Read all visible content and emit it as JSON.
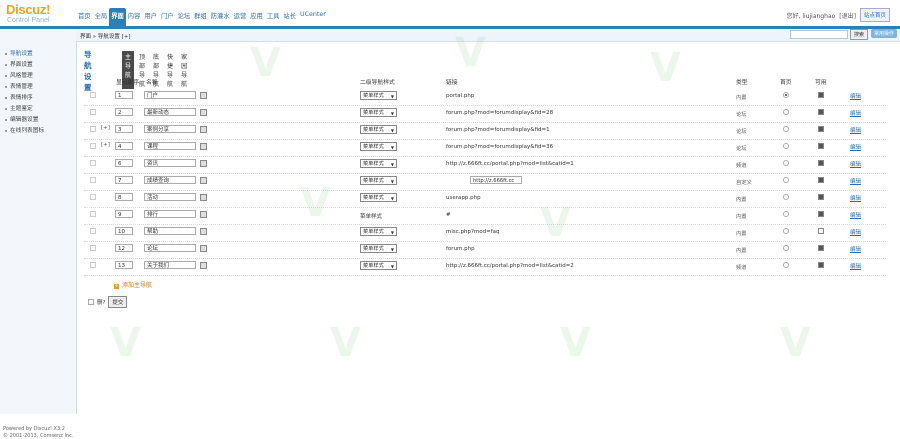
{
  "logo": {
    "name": "Discuz!",
    "sub": "Control Panel"
  },
  "nav": [
    "首页",
    "全局",
    "界面",
    "内容",
    "用户",
    "门户",
    "论坛",
    "群组",
    "防灌水",
    "运营",
    "应用",
    "工具",
    "站长",
    "UCenter"
  ],
  "nav_active_index": 2,
  "user": {
    "greeting": "您好, liujianghao",
    "logout": "[退出]",
    "site_home": "站点首页"
  },
  "breadcrumb": "界面 » 导航设置 [+]",
  "search": {
    "button": "搜索",
    "button2": "常用操作"
  },
  "sidebar": [
    "导航设置",
    "界面设置",
    "风格管理",
    "表情管理",
    "表情排序",
    "主题鉴定",
    "编辑器设置",
    "在线列表图标"
  ],
  "sidebar_active_index": 0,
  "powered": [
    "Powered by Discuz! X3.2",
    "© 2001-2013, Comsenz Inc."
  ],
  "page_title": "导航设置",
  "tabs": [
    "主导航",
    "顶部导航",
    "底部导航",
    "快捷导航",
    "家园导航"
  ],
  "tabs_active_index": 0,
  "headers": {
    "order": "显示顺序",
    "name": "名称",
    "submenu": "二级导航样式",
    "url": "链接",
    "type": "类型",
    "home": "首页",
    "enable": "可用"
  },
  "rows": [
    {
      "expand": "",
      "order": "1",
      "name": "门户",
      "submenu": "菜单样式",
      "url": "portal.php",
      "type": "内置",
      "home": true,
      "enabled": true,
      "edit": "编辑"
    },
    {
      "expand": "",
      "order": "2",
      "name": "最新动态",
      "submenu": "菜单样式",
      "url": "forum.php?mod=forumdisplay&fid=28",
      "type": "论坛",
      "home": false,
      "enabled": true,
      "edit": "编辑"
    },
    {
      "expand": "[+]",
      "order": "3",
      "name": "案例分享",
      "submenu": "菜单样式",
      "url": "forum.php?mod=forumdisplay&fid=1",
      "type": "论坛",
      "home": false,
      "enabled": true,
      "edit": "编辑"
    },
    {
      "expand": "[+]",
      "order": "4",
      "name": "课程",
      "submenu": "菜单样式",
      "url": "forum.php?mod=forumdisplay&fid=36",
      "type": "论坛",
      "home": false,
      "enabled": true,
      "edit": "编辑"
    },
    {
      "expand": "",
      "order": "6",
      "name": "资讯",
      "submenu": "菜单样式",
      "url": "http://z.666ft.cc/portal.php?mod=list&catid=1",
      "type": "频道",
      "home": false,
      "enabled": true,
      "edit": "编辑"
    },
    {
      "expand": "",
      "order": "7",
      "name": "成绩查询",
      "submenu": "菜单样式",
      "urlbox": "http://z.666ft.cc",
      "type": "自定义",
      "home": false,
      "enabled": true,
      "edit": "编辑"
    },
    {
      "expand": "",
      "order": "8",
      "name": "活动",
      "submenu": "菜单样式",
      "url": "userapp.php",
      "type": "内置",
      "home": false,
      "enabled": true,
      "edit": "编辑"
    },
    {
      "expand": "",
      "order": "9",
      "name": "排行",
      "submenu": "",
      "plain": "菜单样式",
      "url": "#",
      "type": "内置",
      "home": false,
      "enabled": true,
      "edit": "编辑"
    },
    {
      "expand": "",
      "order": "10",
      "name": "帮助",
      "submenu": "菜单样式",
      "url": "misc.php?mod=faq",
      "type": "内置",
      "home": false,
      "enabled": false,
      "edit": "编辑"
    },
    {
      "expand": "",
      "order": "12",
      "name": "论坛",
      "submenu": "菜单样式",
      "url": "forum.php",
      "type": "内置",
      "home": false,
      "enabled": true,
      "edit": "编辑"
    },
    {
      "expand": "",
      "order": "13",
      "name": "关于我们",
      "submenu": "菜单样式",
      "url": "http://z.666ft.cc/portal.php?mod=list&catid=2",
      "type": "频道",
      "home": false,
      "enabled": true,
      "edit": "编辑"
    }
  ],
  "add_new": "添加主导航",
  "bottom": {
    "delete_label": "删?",
    "submit": "提交"
  },
  "colors": {
    "brand": "#2e7fb6",
    "logo": "#f2a21a"
  }
}
